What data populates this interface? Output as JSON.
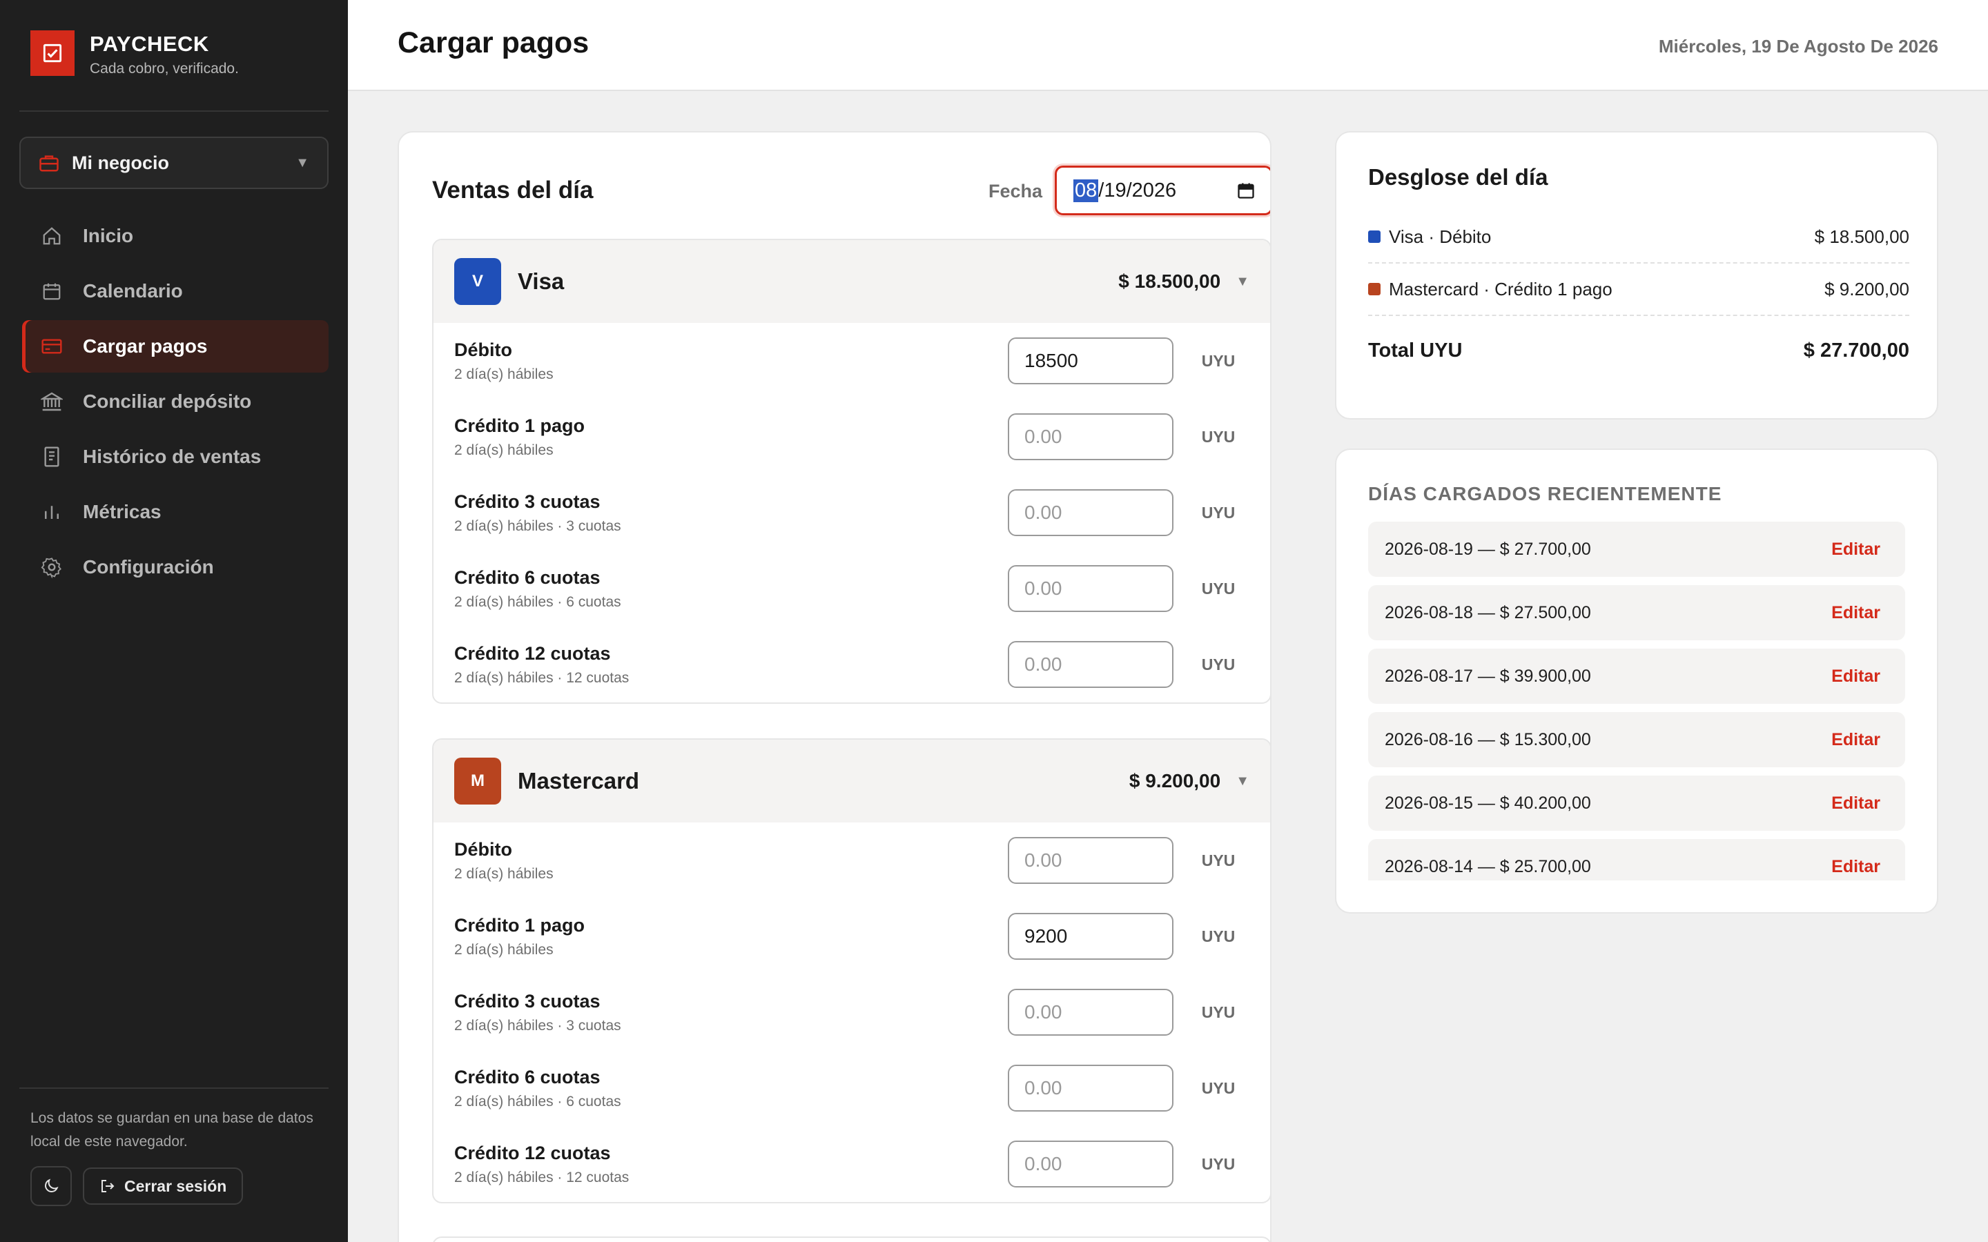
{
  "brand": {
    "name": "PAYCHECK",
    "tagline": "Cada cobro, verificado."
  },
  "business": {
    "label": "Mi negocio"
  },
  "nav": [
    {
      "label": "Inicio",
      "icon": "home-icon"
    },
    {
      "label": "Calendario",
      "icon": "calendar-icon"
    },
    {
      "label": "Cargar pagos",
      "icon": "credit-card-icon",
      "active": true
    },
    {
      "label": "Conciliar depósito",
      "icon": "bank-icon"
    },
    {
      "label": "Histórico de ventas",
      "icon": "receipt-icon"
    },
    {
      "label": "Métricas",
      "icon": "bar-chart-icon"
    },
    {
      "label": "Configuración",
      "icon": "gear-icon"
    }
  ],
  "footer": {
    "note": "Los datos se guardan en una base de datos local de este navegador.",
    "logout": "Cerrar sesión"
  },
  "header": {
    "title": "Cargar pagos",
    "date": "Miércoles, 19 De Agosto De 2026"
  },
  "sales": {
    "title": "Ventas del día",
    "date_label": "Fecha",
    "date_value": {
      "month": "08",
      "rest": "/19/2026"
    },
    "brands": [
      {
        "badge": "V",
        "name": "Visa",
        "total": "$ 18.500,00",
        "color": "#1f4fb8",
        "rows": [
          {
            "title": "Débito",
            "sub": "2 día(s) hábiles",
            "value": "18500",
            "placeholder": "0.00",
            "currency": "UYU"
          },
          {
            "title": "Crédito 1 pago",
            "sub": "2 día(s) hábiles",
            "value": "",
            "placeholder": "0.00",
            "currency": "UYU"
          },
          {
            "title": "Crédito 3 cuotas",
            "sub": "2 día(s) hábiles · 3 cuotas",
            "value": "",
            "placeholder": "0.00",
            "currency": "UYU"
          },
          {
            "title": "Crédito 6 cuotas",
            "sub": "2 día(s) hábiles · 6 cuotas",
            "value": "",
            "placeholder": "0.00",
            "currency": "UYU"
          },
          {
            "title": "Crédito 12 cuotas",
            "sub": "2 día(s) hábiles · 12 cuotas",
            "value": "",
            "placeholder": "0.00",
            "currency": "UYU"
          }
        ]
      },
      {
        "badge": "M",
        "name": "Mastercard",
        "total": "$ 9.200,00",
        "color": "#b8441f",
        "rows": [
          {
            "title": "Débito",
            "sub": "2 día(s) hábiles",
            "value": "",
            "placeholder": "0.00",
            "currency": "UYU"
          },
          {
            "title": "Crédito 1 pago",
            "sub": "2 día(s) hábiles",
            "value": "9200",
            "placeholder": "0.00",
            "currency": "UYU"
          },
          {
            "title": "Crédito 3 cuotas",
            "sub": "2 día(s) hábiles · 3 cuotas",
            "value": "",
            "placeholder": "0.00",
            "currency": "UYU"
          },
          {
            "title": "Crédito 6 cuotas",
            "sub": "2 día(s) hábiles · 6 cuotas",
            "value": "",
            "placeholder": "0.00",
            "currency": "UYU"
          },
          {
            "title": "Crédito 12 cuotas",
            "sub": "2 día(s) hábiles · 12 cuotas",
            "value": "",
            "placeholder": "0.00",
            "currency": "UYU"
          }
        ]
      }
    ]
  },
  "breakdown": {
    "title": "Desglose del día",
    "items": [
      {
        "label": "Visa · Débito",
        "value": "$ 18.500,00",
        "color": "#1f4fb8"
      },
      {
        "label": "Mastercard · Crédito 1 pago",
        "value": "$ 9.200,00",
        "color": "#b8441f"
      }
    ],
    "total_label": "Total UYU",
    "total_value": "$ 27.700,00"
  },
  "recent": {
    "title": "DÍAS CARGADOS RECIENTEMENTE",
    "edit_label": "Editar",
    "items": [
      "2026-08-19 — $ 27.700,00",
      "2026-08-18 — $ 27.500,00",
      "2026-08-17 — $ 39.900,00",
      "2026-08-16 — $ 15.300,00",
      "2026-08-15 — $ 40.200,00",
      "2026-08-14 — $ 25.700,00"
    ]
  },
  "colors": {
    "accent": "#d42a1a",
    "sidebar_bg": "#1f1f1f",
    "page_bg": "#f0f0f0"
  }
}
